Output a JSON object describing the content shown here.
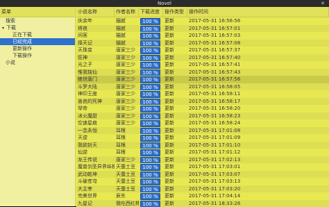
{
  "window": {
    "title": "Novel",
    "close_glyph": "✕"
  },
  "sidebar": {
    "header": "菜单",
    "items": [
      {
        "label": "搜索",
        "level": 1,
        "arrow": "",
        "selected": false
      },
      {
        "label": "下载",
        "level": 0,
        "arrow": "▾",
        "selected": false
      },
      {
        "label": "正在下载",
        "level": 2,
        "arrow": "",
        "selected": false
      },
      {
        "label": "已经完成",
        "level": 2,
        "arrow": "",
        "selected": true
      },
      {
        "label": "更新操作",
        "level": 2,
        "arrow": "",
        "selected": false
      },
      {
        "label": "下载操作",
        "level": 2,
        "arrow": "",
        "selected": false
      },
      {
        "label": "小说",
        "level": 1,
        "arrow": "",
        "selected": false
      }
    ]
  },
  "table": {
    "columns": [
      "小说名称",
      "作者名称",
      "下载进度",
      "操作类型",
      "操作时间"
    ],
    "rows": [
      {
        "name": "庆余年",
        "author": "猫腻",
        "progress": "100 %",
        "type": "更新",
        "time": "2017-05-31 16:56:56"
      },
      {
        "name": "将夜",
        "author": "猫腻",
        "progress": "100 %",
        "type": "更新",
        "time": "2017-05-31 16:57:01"
      },
      {
        "name": "间客",
        "author": "猫腻",
        "progress": "100 %",
        "type": "更新",
        "time": "2017-05-31 16:57:03"
      },
      {
        "name": "择天记",
        "author": "猫腻",
        "progress": "100 %",
        "type": "更新",
        "time": "2017-05-31 16:57:08"
      },
      {
        "name": "天珠变",
        "author": "唐家三少",
        "progress": "100 %",
        "type": "更新",
        "time": "2017-05-31 16:57:37"
      },
      {
        "name": "狂神",
        "author": "唐家三少",
        "progress": "100 %",
        "type": "更新",
        "time": "2017-05-31 16:57:40"
      },
      {
        "name": "光之子",
        "author": "唐家三少",
        "progress": "100 %",
        "type": "更新",
        "time": "2017-05-31 16:57:41"
      },
      {
        "name": "惟我独仙",
        "author": "唐家三少",
        "progress": "100 %",
        "type": "更新",
        "time": "2017-05-31 16:57:43"
      },
      {
        "name": "绝世唐门",
        "author": "唐家三少",
        "progress": "100 %",
        "type": "更新",
        "time": "2017-05-31 16:57:56"
      },
      {
        "name": "斗罗大陆",
        "author": "唐家三少",
        "progress": "100 %",
        "type": "更新",
        "time": "2017-05-31 16:58:05"
      },
      {
        "name": "神印王座",
        "author": "唐家三少",
        "progress": "100 %",
        "type": "更新",
        "time": "2017-05-31 16:58:11"
      },
      {
        "name": "善良的死神",
        "author": "唐家三少",
        "progress": "100 %",
        "type": "更新",
        "time": "2017-05-31 16:58:17"
      },
      {
        "name": "琴帝",
        "author": "唐家三少",
        "progress": "100 %",
        "type": "更新",
        "time": "2017-05-31 16:58:20"
      },
      {
        "name": "冰火魔厨",
        "author": "唐家三少",
        "progress": "100 %",
        "type": "更新",
        "time": "2017-05-31 16:58:23"
      },
      {
        "name": "空速星痕",
        "author": "唐家三少",
        "progress": "100 %",
        "type": "更新",
        "time": "2017-05-31 16:58:24"
      },
      {
        "name": "一念永恒",
        "author": "耳根",
        "progress": "100 %",
        "type": "更新",
        "time": "2017-05-31 17:01:08"
      },
      {
        "name": "天逆",
        "author": "耳根",
        "progress": "100 %",
        "type": "更新",
        "time": "2017-05-31 17:01:09"
      },
      {
        "name": "我欲封天",
        "author": "耳根",
        "progress": "100 %",
        "type": "更新",
        "time": "2017-05-31 17:01:10"
      },
      {
        "name": "仙逆",
        "author": "耳根",
        "progress": "100 %",
        "type": "更新",
        "time": "2017-05-31 17:01:12"
      },
      {
        "name": "龙王传说",
        "author": "唐家三少",
        "progress": "100 %",
        "type": "更新",
        "time": "2017-05-31 17:02:13"
      },
      {
        "name": "魔兽剑圣异界纵横",
        "author": "天蚕土豆",
        "progress": "100 %",
        "type": "更新",
        "time": "2017-05-31 17:03:01"
      },
      {
        "name": "武动乾坤",
        "author": "天蚕土豆",
        "progress": "100 %",
        "type": "更新",
        "time": "2017-05-31 17:03:07"
      },
      {
        "name": "斗破苍穹",
        "author": "天蚕土豆",
        "progress": "100 %",
        "type": "更新",
        "time": "2017-05-31 17:03:13"
      },
      {
        "name": "大主宰",
        "author": "天蚕土豆",
        "progress": "100 %",
        "type": "更新",
        "time": "2017-05-31 17:03:20"
      },
      {
        "name": "完美世界",
        "author": "辰东",
        "progress": "100 %",
        "type": "更新",
        "time": "2017-05-31 17:04:14"
      },
      {
        "name": "九星记",
        "author": "我吃西红柿",
        "progress": "100 %",
        "type": "更新",
        "time": "2017-05-31 18:33:26"
      }
    ],
    "highlight_index": 8
  }
}
